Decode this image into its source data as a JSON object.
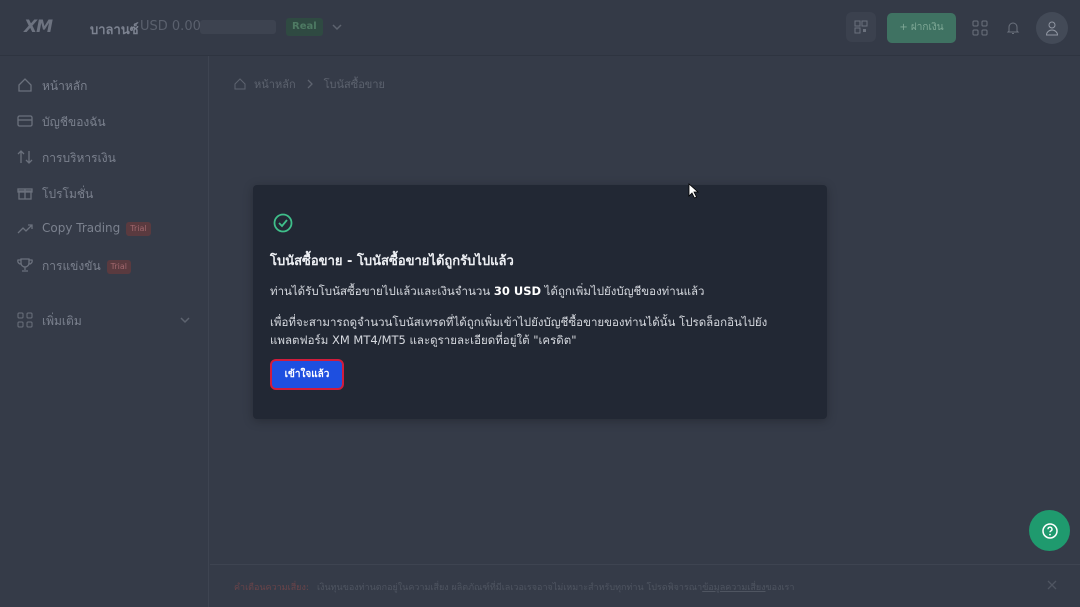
{
  "header": {
    "logo": "XM",
    "balance_label": "บาลานซ์",
    "balance_value": "USD 0.00",
    "account_type": "Real",
    "deposit_label": "+ ฝากเงิน"
  },
  "sidebar": {
    "items": [
      {
        "label": "หน้าหลัก",
        "icon": "home-icon"
      },
      {
        "label": "บัญชีของฉัน",
        "icon": "wallet-icon"
      },
      {
        "label": "การบริหารเงิน",
        "icon": "transfer-icon"
      },
      {
        "label": "โปรโมชั่น",
        "icon": "gift-icon"
      },
      {
        "label": "Copy Trading",
        "icon": "trend-icon",
        "badge": "Trial"
      },
      {
        "label": "การแข่งขัน",
        "icon": "trophy-icon",
        "badge": "Trial"
      },
      {
        "label": "เพิ่มเติม",
        "icon": "grid-icon"
      }
    ]
  },
  "breadcrumb": {
    "home": "หน้าหลัก",
    "current": "โบนัสซื้อขาย"
  },
  "modal": {
    "title": "โบนัสซื้อขาย - โบนัสซื้อขายได้ถูกรับไปแล้ว",
    "p1_before": "ท่านได้รับโบนัสซื้อขายไปแล้วและเงินจำนวน ",
    "p1_amount": "30 USD",
    "p1_after": " ได้ถูกเพิ่มไปยังบัญชีของท่านแล้ว",
    "p2": "เพื่อที่จะสามารถดูจำนวนโบนัสเทรดที่ได้ถูกเพิ่มเข้าไปยังบัญชีซื้อขายของท่านได้นั้น โปรดล็อกอินไปยังแพลตฟอร์ม XM MT4/MT5 และดูรายละเอียดที่อยู่ใต้ \"เครดิต\"",
    "ok_label": "เข้าใจแล้ว"
  },
  "notice": {
    "warning": "คำเตือนความเสี่ยง:",
    "text": "เงินทุนของท่านตกอยู่ในความเสี่ยง ผลิตภัณฑ์ที่มีเลเวอเรจอาจไม่เหมาะสำหรับทุกท่าน โปรดพิจารณา",
    "link": "ข้อมูลความเสี่ยง",
    "suffix": "ของเรา"
  },
  "colors": {
    "accent_green": "#1f9a6e",
    "primary_blue": "#1e4fe0",
    "focus_red": "#d11c3c",
    "success_check": "#3fbf8a"
  }
}
